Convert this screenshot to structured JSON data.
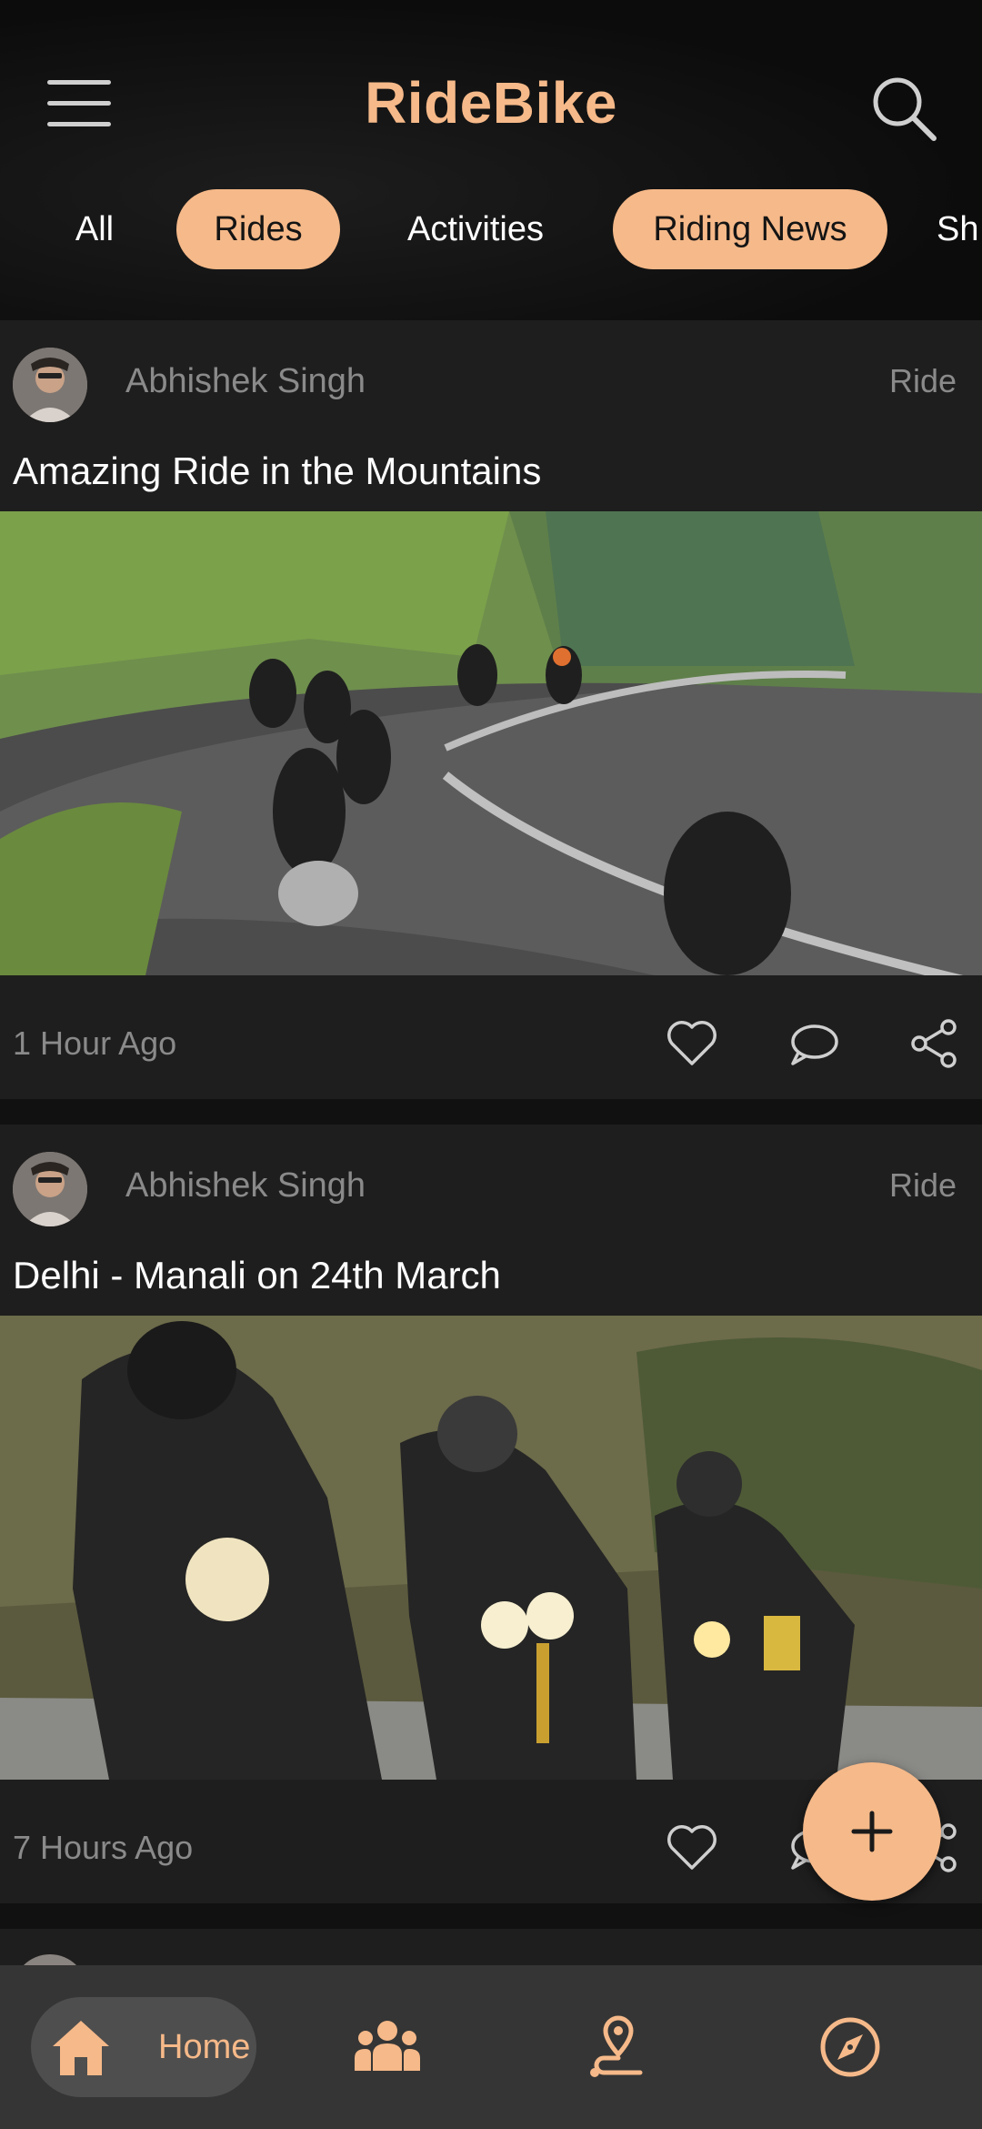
{
  "app": {
    "title": "RideBike"
  },
  "header": {
    "menu_icon": "hamburger-icon",
    "search_icon": "search-icon"
  },
  "tabs": [
    {
      "label": "All",
      "active": false
    },
    {
      "label": "Rides",
      "active": true
    },
    {
      "label": "Activities",
      "active": false
    },
    {
      "label": "Riding News",
      "active": true
    },
    {
      "label": "Sh",
      "active": false
    }
  ],
  "posts": [
    {
      "author": "Abhishek Singh",
      "type": "Ride",
      "title": "Amazing Ride in the Mountains",
      "time": "1 Hour Ago"
    },
    {
      "author": "Abhishek Singh",
      "type": "Ride",
      "title": "Delhi - Manali on 24th March",
      "time": "7 Hours Ago"
    }
  ],
  "fab": {
    "icon": "plus-icon"
  },
  "bottom_nav": {
    "home_label": "Home",
    "icons": [
      "home-icon",
      "community-icon",
      "route-icon",
      "compass-icon"
    ]
  },
  "colors": {
    "accent": "#f6b989",
    "card": "#1e1e1e",
    "background": "#141414",
    "nav": "#353535"
  }
}
